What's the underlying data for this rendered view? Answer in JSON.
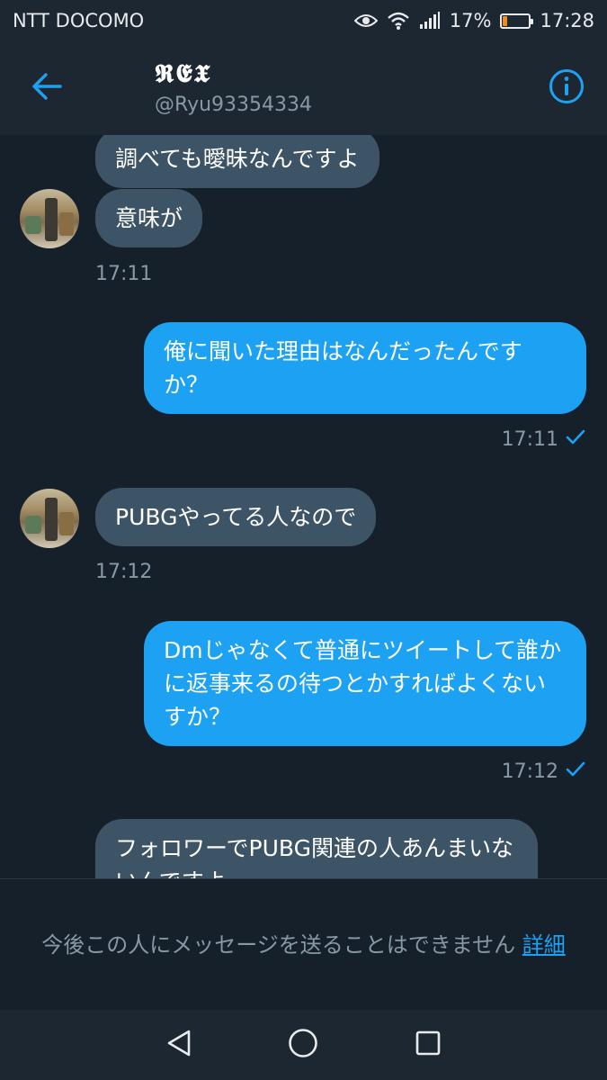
{
  "status_bar": {
    "carrier": "NTT DOCOMO",
    "battery_percent": "17%",
    "battery_level": 0.17,
    "time": "17:28"
  },
  "header": {
    "display_name": "𝕽𝕰𝖃",
    "handle": "@Ryu93354334"
  },
  "messages": [
    {
      "direction": "in",
      "text": "調べても曖昧なんですよ"
    },
    {
      "direction": "in",
      "text": "意味が"
    },
    {
      "direction": "in",
      "time": "17:11"
    },
    {
      "direction": "out",
      "text": "俺に聞いた理由はなんだったんですか？",
      "time": "17:11"
    },
    {
      "direction": "in",
      "text": "PUBGやってる人なので",
      "time": "17:12"
    },
    {
      "direction": "out",
      "text": "Dmじゃなくて普通にツイートして誰かに返事来るの待つとかすればよくないすか？",
      "time": "17:12"
    },
    {
      "direction": "in",
      "text": "フォロワーでPUBG関連の人あんまいないんですよ"
    }
  ],
  "notice": {
    "text": "今後この人にメッセージを送ることはできません",
    "link": "詳細"
  },
  "colors": {
    "background": "#15202b",
    "bar": "#1c2732",
    "incoming_bubble": "#3d5466",
    "outgoing_bubble": "#1da1f2",
    "accent": "#1da1f2",
    "muted_text": "#8899a6"
  },
  "icons": {
    "back": "back-arrow-icon",
    "info": "info-icon",
    "sent": "checkmark-icon",
    "nav_back": "triangle-back-icon",
    "nav_home": "circle-home-icon",
    "nav_recents": "square-recents-icon"
  }
}
